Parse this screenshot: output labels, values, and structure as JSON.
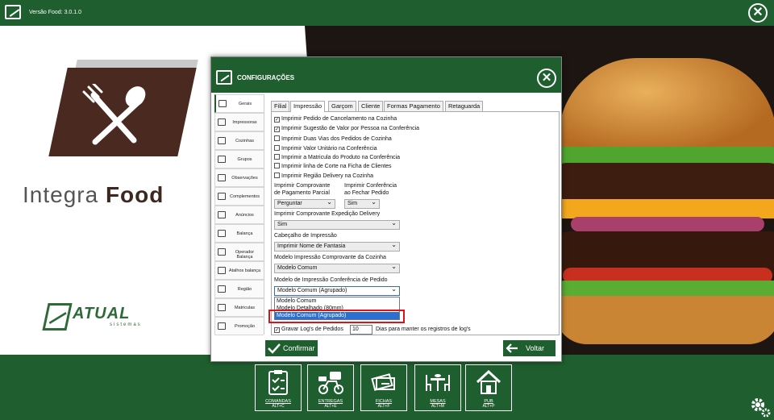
{
  "app": {
    "version": "Versão Food: 3.0.1.0"
  },
  "brand": {
    "name_light": "Integra ",
    "name_bold": "Food",
    "company": "ATUAL",
    "company_sub": "sistemas"
  },
  "dialog": {
    "title": "CONFIGURAÇÕES",
    "sidebar": [
      {
        "label": "Gerais",
        "icon": "gears-icon",
        "active": true
      },
      {
        "label": "Impressoras",
        "icon": "printer-icon"
      },
      {
        "label": "Cozinhas",
        "icon": "kitchen-icon"
      },
      {
        "label": "Grupos",
        "icon": "groups-icon"
      },
      {
        "label": "Observações",
        "icon": "notes-icon"
      },
      {
        "label": "Complementos",
        "icon": "complements-icon"
      },
      {
        "label": "Anúncios",
        "icon": "ads-icon"
      },
      {
        "label": "Balança",
        "icon": "scale-icon"
      },
      {
        "label": "Operador Balança",
        "icon": "scale-operator-icon"
      },
      {
        "label": "Atalhos balança",
        "icon": "shortcut-icon"
      },
      {
        "label": "Região",
        "icon": "flag-icon"
      },
      {
        "label": "Matriculas",
        "icon": "badge-icon"
      },
      {
        "label": "Promoção",
        "icon": "promo-icon"
      }
    ],
    "tabs": [
      "Filial",
      "Impressão",
      "Garçom",
      "Cliente",
      "Formas Pagamento",
      "Retaguarda"
    ],
    "active_tab": "Impressão",
    "checkboxes": [
      {
        "label": "Imprimir Pedido de Cancelamento na Cozinha",
        "checked": true
      },
      {
        "label": "Imprimir Sugestão de Valor por Pessoa na Conferência",
        "checked": true
      },
      {
        "label": "Imprimir Duas Vias dos Pedidos de Cozinha",
        "checked": false
      },
      {
        "label": "Imprimir Valor Unitário na Conferência",
        "checked": false
      },
      {
        "label": "Imprimir a Matricula do Produto na Conferência",
        "checked": false
      },
      {
        "label": "Imprimir linha de Corte na Ficha de Clientes",
        "checked": false
      },
      {
        "label": "Imprimir Região Delivery na Cozinha",
        "checked": false
      }
    ],
    "fields": {
      "comprovante_parcial_label1": "Imprimir Comprovante",
      "comprovante_parcial_label2": "de Pagamento Parcial",
      "comprovante_parcial_value": "Perguntar",
      "conferencia_fechar_label1": "Imprimir Conferência",
      "conferencia_fechar_label2": "ao Fechar Pedido",
      "conferencia_fechar_value": "Sim",
      "expedicao_label": "Imprimir Comprovante Expedição Delivery",
      "expedicao_value": "Sim",
      "cabecalho_label": "Cabeçalho de Impressão",
      "cabecalho_value": "Imprimir Nome de Fantasia",
      "modelo_cozinha_label": "Modelo Impressão Comprovante da Cozinha",
      "modelo_cozinha_value": "Modelo Comum",
      "modelo_conferencia_label": "Modelo de Impressão Conferência de Pedido",
      "modelo_conferencia_value": "Modelo Comum (Agrupado)",
      "modelo_conferencia_options": [
        "Modelo Comum",
        "Modelo Detalhado (80mm)",
        "Modelo Comum (Agrupado)"
      ],
      "gravar_logs_label": "Gravar Log's de Pedidos",
      "gravar_logs_checked": true,
      "dias_value": "10",
      "dias_label": "Dias para manter os registros de log's"
    },
    "buttons": {
      "confirm": "Confirmar",
      "back": "Voltar"
    }
  },
  "bottom_nav": [
    {
      "label": "COMANDAS",
      "key": "ALT+C",
      "icon": "clipboard-icon"
    },
    {
      "label": "ENTREGAS",
      "key": "ALT+E",
      "icon": "scooter-icon"
    },
    {
      "label": "FICHAS",
      "key": "ALT+F",
      "icon": "tickets-icon"
    },
    {
      "label": "MESAS",
      "key": "ALT+M",
      "icon": "table-icon"
    },
    {
      "label": "PUB",
      "key": "ALT+P",
      "icon": "house-icon"
    }
  ],
  "colors": {
    "primary_green": "#1f5e2e",
    "highlight": "#2a6fd1",
    "annotation_red": "#d9141b"
  }
}
